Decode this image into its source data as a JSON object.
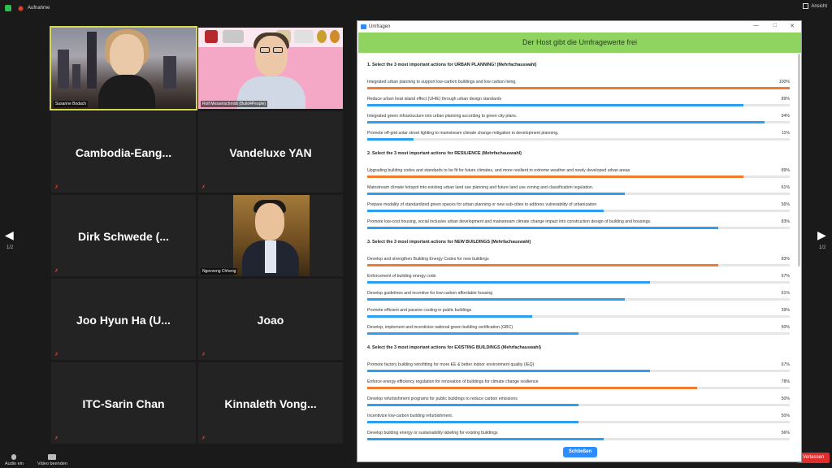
{
  "topbar": {
    "recording_label": "Aufnahme",
    "view_label": "Ansicht"
  },
  "page_indicator": {
    "left": "1/2",
    "right": "1/2"
  },
  "participants": {
    "t1": "Susanne Bodach",
    "t2": "Rolf Messerschmidt (Build4People)",
    "t3": "Cambodia-Eang...",
    "t4": "Vandeluxe YAN",
    "t5": "Dirk Schwede (...",
    "t6": "Ngovveng Chheng",
    "t7": "Joo Hyun Ha (U...",
    "t8": "Joao",
    "t9": "ITC-Sarin Chan",
    "t10": "Kinnaleth Vong..."
  },
  "bottom": {
    "audio": "Audio ein",
    "video": "Video beenden",
    "leave": "Verlassen"
  },
  "poll": {
    "window_title": "Umfragen",
    "header": "Der Host gibt die Umfragewerte frei",
    "close_button": "Schließen",
    "colors": {
      "top": "#f07a2e",
      "regular": "#2e9ef0",
      "track": "#e6e6e6",
      "header": "#8fd461"
    },
    "questions": [
      {
        "title": "1. Select the 3 most important actions for URBAN PLANNING! (Mehrfachauswahl)",
        "options": [
          {
            "text": "Integrated urban planning to support low-carbon buildings and low carbon living.",
            "pct": "100%",
            "value": 100,
            "top": true
          },
          {
            "text": "Reduce urban heat island effect (UHIE) through urban design standards",
            "pct": "89%",
            "value": 89,
            "top": false
          },
          {
            "text": "Integrated green infrastructure into urban planning according to green city plans.",
            "pct": "94%",
            "value": 94,
            "top": false
          },
          {
            "text": "Promote off-grid solar street lighting to mainstream climate change mitigation in development planning.",
            "pct": "11%",
            "value": 11,
            "top": false
          }
        ]
      },
      {
        "title": "2. Select the 3 most important actions for RESILIENCE (Mehrfachauswahl)",
        "options": [
          {
            "text": "Upgrading building codes and standards to be fit for future climates, and more resilient to extreme weather and newly developed urban areas",
            "pct": "89%",
            "value": 89,
            "top": true
          },
          {
            "text": "Mainstream climate hotspot into existing urban land use planning and future land use zoning and classification regulation.",
            "pct": "61%",
            "value": 61,
            "top": false
          },
          {
            "text": "Prepare modality of standardized green spaces for urban planning or new sub-cities to address vulnerability of urbanization",
            "pct": "56%",
            "value": 56,
            "top": false
          },
          {
            "text": "Promote low-cost housing, social inclusive urban development and mainstream climate change impact into construction design of building and housings.",
            "pct": "83%",
            "value": 83,
            "top": false
          }
        ]
      },
      {
        "title": "3. Select the 3 most important actions for NEW BUILDINGS (Mehrfachauswahl)",
        "options": [
          {
            "text": "Develop and strengthen Building Energy Codes for new buildings",
            "pct": "83%",
            "value": 83,
            "top": true
          },
          {
            "text": "Enforcement of building energy code",
            "pct": "67%",
            "value": 67,
            "top": false
          },
          {
            "text": "Develop guidelines and incentive for low-carbon affordable housing",
            "pct": "61%",
            "value": 61,
            "top": false
          },
          {
            "text": "Promote efficient and passive cooling in public buildings",
            "pct": "39%",
            "value": 39,
            "top": false
          },
          {
            "text": "Develop, implement and incentivize national green building certification (GBC)",
            "pct": "50%",
            "value": 50,
            "top": false
          }
        ]
      },
      {
        "title": "4. Select the 3 most important actions for EXISTING BUILDINGS (Mehrfachauswahl)",
        "options": [
          {
            "text": "Promote factory building retrofitting for more EE & better indoor environment quality (IEQ)",
            "pct": "67%",
            "value": 67,
            "top": false
          },
          {
            "text": "Enforce energy efficiency regulation for renovation of buildings for climate change resilience",
            "pct": "78%",
            "value": 78,
            "top": true
          },
          {
            "text": "Develop refurbishment programs for public buildings to reduce carbon emissions",
            "pct": "50%",
            "value": 50,
            "top": false
          },
          {
            "text": "Incentivize low-carbon building refurbishment.",
            "pct": "50%",
            "value": 50,
            "top": false
          },
          {
            "text": "Develop building energy or sustainability labeling for existing buildings",
            "pct": "56%",
            "value": 56,
            "top": false
          }
        ]
      }
    ]
  }
}
